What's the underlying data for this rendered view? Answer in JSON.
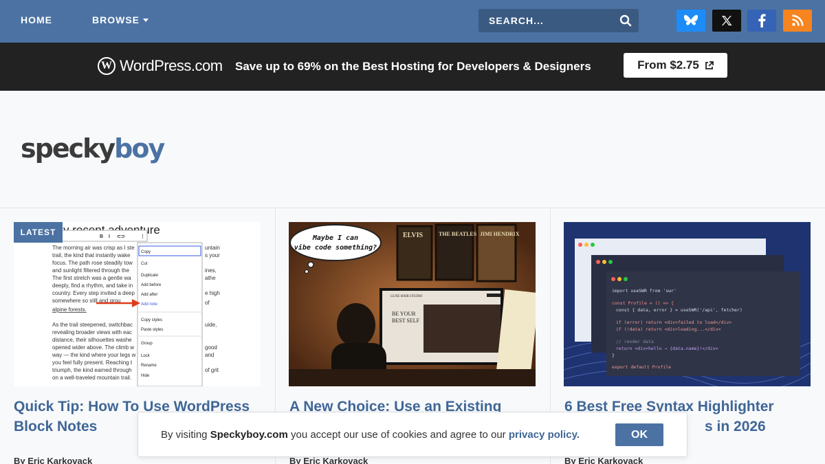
{
  "nav": {
    "home": "HOME",
    "browse": "BROWSE",
    "search_placeholder": "SEARCH..."
  },
  "social": [
    "bluesky-icon",
    "x-icon",
    "facebook-icon",
    "rss-icon"
  ],
  "banner": {
    "brand": "WordPress.com",
    "text": "Save up to 69% on the Best Hosting for Developers & Designers",
    "button": "From $2.75"
  },
  "logo": {
    "part1": "specky",
    "part2": "boy"
  },
  "cards": [
    {
      "badge": "LATEST",
      "title": "Quick Tip: How To Use WordPress Block Notes",
      "byline": "By Eric Karkovack",
      "image_heading": "y recent adventure",
      "image_menu": [
        "Copy",
        "Cut",
        "Duplicate",
        "Add before",
        "Add after",
        "Add note",
        "Copy styles",
        "Paste styles",
        "Group",
        "Lock",
        "Rename",
        "Hide"
      ],
      "image_text": [
        "The morning air was crisp as I ste",
        "trail, the kind that instantly wake",
        "focus. The path rose steadily tow",
        "and sunlight filtered through the",
        "The first stretch was a gentle wa",
        "deeply, find a rhythm, and take in",
        "country. Every step invited a deep",
        "somewhere so still and grou",
        "alpine forests.",
        "As the trail steepened, switchbac",
        "revealing broader views with eac",
        "distance, their silhouettes washe",
        "opened wider above. The climb w",
        "way — the kind where your legs w",
        "you feel fully present. Reaching t",
        "triumph, the kind earned through",
        "on a well-traveled mountain trail."
      ]
    },
    {
      "title": "A New Choice: Use an Existing",
      "byline": "By Eric Karkovack",
      "image_bubble": [
        "Maybe I can",
        "vibe code something?"
      ],
      "image_posters": [
        "ELVIS",
        "THE BEATLES",
        "JIMI HENDRIX"
      ],
      "image_screen": [
        "LUXE HAIR STUDIO",
        "BE YOUR",
        "BEST SELF"
      ]
    },
    {
      "title": "6 Best Free Syntax Highlighter",
      "title_tail": "s in 2026",
      "byline": "By Eric Karkovack",
      "image_code": [
        "import useSWR from 'swr'",
        "const Profile = () => {",
        "const { data, error } = useSWR('/api', fetcher)",
        "if (error) return <div>failed to load</div>",
        "if (!data) return <div>loading...</div>",
        "// render data",
        "return <div>hello → {data.name}!</div>",
        "}",
        "export default Profile"
      ]
    }
  ],
  "cookie": {
    "text_before": "By visiting ",
    "site": "Speckyboy.com",
    "text_after": " you accept our use of cookies and agree to our ",
    "link": "privacy policy.",
    "button": "OK"
  },
  "colors": {
    "nav": "#4b72a3",
    "banner": "#222222",
    "link": "#3f6696"
  }
}
